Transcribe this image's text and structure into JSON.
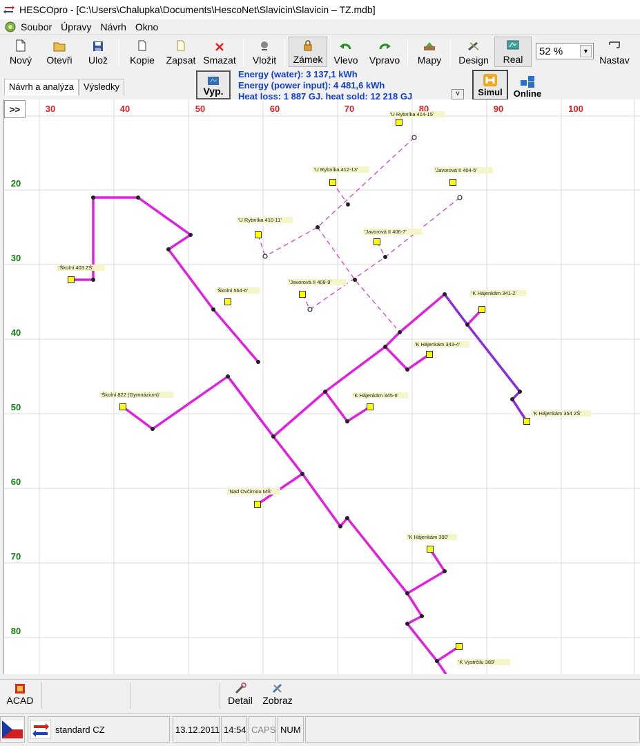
{
  "window": {
    "title": "HESCOpro - [C:\\Users\\Chalupka\\Documents\\HescoNet\\Slavicin\\Slavicin – TZ.mdb]"
  },
  "menu": [
    "Soubor",
    "Úpravy",
    "Návrh",
    "Okno"
  ],
  "toolbar": {
    "novy": "Nový",
    "otevri": "Otevři",
    "uloz": "Ulož",
    "kopie": "Kopie",
    "zapsat": "Zapsat",
    "smazat": "Smazat",
    "vlozit": "Vložit",
    "zamek": "Zámek",
    "vlevo": "Vlevo",
    "vpravo": "Vpravo",
    "mapy": "Mapy",
    "design": "Design",
    "real": "Real",
    "zoom": "52 %",
    "nastav": "Nastav"
  },
  "tabs": [
    "Návrh a analýza",
    "Výsledky"
  ],
  "calc": {
    "vyp_label": "Vyp.",
    "v_label": "v"
  },
  "energy": {
    "line1": "Energy (water):  3 137,1 kWh",
    "line2": "Energy (power input):  4 481,6 kWh",
    "line3": "Heat loss:  1 887 GJ, heat sold:  12 218 GJ"
  },
  "mode": {
    "simul": "Simul",
    "online": "Online"
  },
  "canvas": {
    "expand": ">>",
    "x_ticks": [
      "30",
      "40",
      "50",
      "60",
      "70",
      "80",
      "90",
      "100"
    ],
    "y_ticks": [
      "20",
      "30",
      "40",
      "50",
      "60",
      "70",
      "80"
    ],
    "labels": [
      "'U Rybníka 414-15'",
      "'U Rybníka 412-13'",
      "'Javorová II 404-5'",
      "'U Rybníka 410-11'",
      "'Javorová II 406-7'",
      "'Školní 403 ZŠ'",
      "'Javorová II 408-9'",
      "'Školní 564-6'",
      "'K Hájenkám 341-2'",
      "'K Hájenkám 343-4'",
      "'Školní 822 (Gymnázium)'",
      "'K Hájenkám 345-6'",
      "'K Hájenkám 354 ZŠ'",
      "'Nad Ovčírnou MŠ'",
      "'K Hájenkám 390'",
      "'K Vystrčilu 389'"
    ]
  },
  "bottom": {
    "acad": "ACAD",
    "detail": "Detail",
    "zobraz": "Zobraz"
  },
  "status": {
    "locale": "standard CZ",
    "date": "13.12.2011",
    "time": "14:54",
    "caps": "CAPS",
    "num": "NUM"
  },
  "colors": {
    "pipe_main": "#e020e0",
    "pipe_alt": "#8a2be2",
    "pipe_dashed": "#cc44cc",
    "consumer": "#ffff00",
    "x_tick": "#e02020",
    "y_tick": "#108010",
    "energy_text": "#1540c8"
  }
}
